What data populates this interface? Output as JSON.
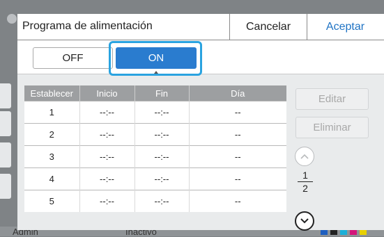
{
  "dialog": {
    "title": "Programa de alimentación",
    "cancel_label": "Cancelar",
    "accept_label": "Aceptar"
  },
  "toggle": {
    "off_label": "OFF",
    "on_label": "ON",
    "selected": "ON"
  },
  "table": {
    "headers": [
      "Establecer",
      "Inicio",
      "Fin",
      "Día"
    ],
    "rows": [
      [
        "1",
        "--:--",
        "--:--",
        "--"
      ],
      [
        "2",
        "--:--",
        "--:--",
        "--"
      ],
      [
        "3",
        "--:--",
        "--:--",
        "--"
      ],
      [
        "4",
        "--:--",
        "--:--",
        "--"
      ],
      [
        "5",
        "--:--",
        "--:--",
        "--"
      ]
    ]
  },
  "side": {
    "edit_label": "Editar",
    "delete_label": "Eliminar",
    "page_current": "1",
    "page_total": "2"
  },
  "background": {
    "user": "Admin",
    "status": "Inactivo"
  },
  "colors": {
    "accent": "#2a7ccf",
    "highlight": "#2aa3e0",
    "header_bg": "#9d9fa1",
    "link": "#1f73c4"
  }
}
